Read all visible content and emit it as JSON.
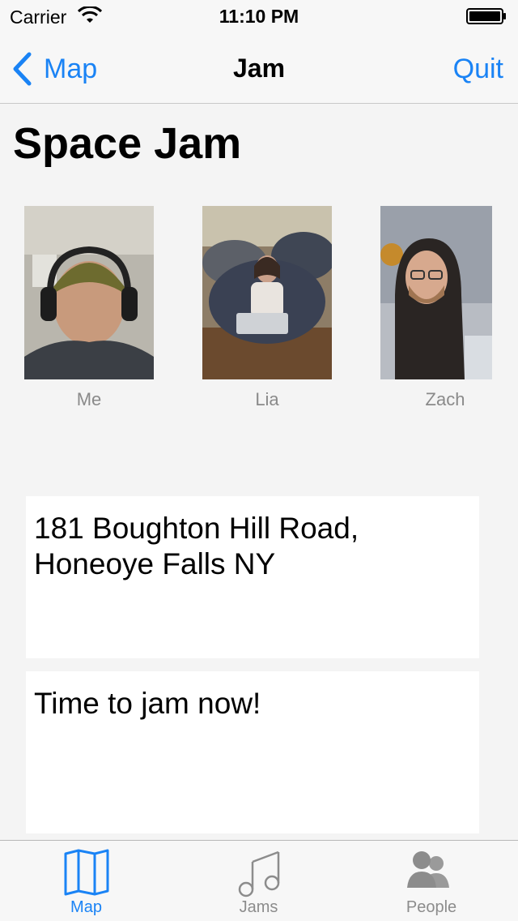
{
  "status_bar": {
    "carrier": "Carrier",
    "time": "11:10 PM"
  },
  "nav": {
    "back_label": "Map",
    "title": "Jam",
    "quit_label": "Quit"
  },
  "jam": {
    "title": "Space Jam",
    "participants": [
      {
        "name": "Me"
      },
      {
        "name": "Lia"
      },
      {
        "name": "Zach"
      }
    ],
    "address": "181 Boughton Hill Road, Honeoye Falls NY",
    "message": "Time to jam now!"
  },
  "tab_bar": {
    "tabs": [
      {
        "label": "Map",
        "icon": "map-icon",
        "active": true
      },
      {
        "label": "Jams",
        "icon": "music-note-icon",
        "active": false
      },
      {
        "label": "People",
        "icon": "people-icon",
        "active": false
      }
    ]
  },
  "colors": {
    "accent": "#1a83f5",
    "inactive": "#8c8c8c",
    "background": "#f4f4f4"
  }
}
